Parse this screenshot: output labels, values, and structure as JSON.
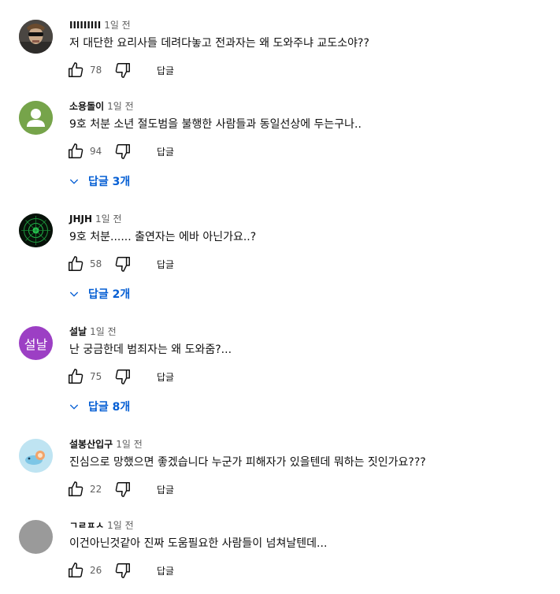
{
  "colors": {
    "link": "#065fd4",
    "secondary_text": "#606060",
    "primary_text": "#0f0f0f"
  },
  "comments": [
    {
      "author": "IIIIIIIII",
      "time": "1일 전",
      "text": "저 대단한 요리사들 데려다놓고 전과자는 왜 도와주냐 교도소야??",
      "likes": "78",
      "reply_label": "답글",
      "avatar": {
        "kind": "photo",
        "bg": "#3a3a3a"
      }
    },
    {
      "author": "소용돌이",
      "time": "1일 전",
      "text": "9호 처분 소년 절도범을 불행한 사람들과 동일선상에 두는구나..",
      "likes": "94",
      "reply_label": "답글",
      "replies_label": "답글 3개",
      "avatar": {
        "kind": "default-person",
        "bg": "#76a44a"
      }
    },
    {
      "author": "JHJH",
      "time": "1일 전",
      "text": "9호 처분...... 출연자는 에바 아닌가요..?",
      "likes": "58",
      "reply_label": "답글",
      "replies_label": "답글 2개",
      "avatar": {
        "kind": "radar",
        "bg": "#0a1a10"
      }
    },
    {
      "author": "설날",
      "time": "1일 전",
      "text": "난 궁금한데 범죄자는 왜 도와줌?...",
      "likes": "75",
      "reply_label": "답글",
      "replies_label": "답글 8개",
      "avatar": {
        "kind": "initials",
        "initials": "설날",
        "bg": "#9c3fc4"
      }
    },
    {
      "author": "설봉산입구",
      "time": "1일 전",
      "text": "진심으로 망했으면 좋겠습니다 누군가 피해자가 있을텐데 뭐하는 짓인가요???",
      "likes": "22",
      "reply_label": "답글",
      "avatar": {
        "kind": "cartoon",
        "bg": "#bfe4f2"
      }
    },
    {
      "author": "ㄱㄹㅍㅅ",
      "time": "1일 전",
      "text": "이건아닌것같아 진짜 도움필요한 사람들이 넘쳐날텐데...",
      "likes": "26",
      "reply_label": "답글",
      "avatar": {
        "kind": "plain",
        "bg": "#9a9a9a"
      }
    }
  ]
}
